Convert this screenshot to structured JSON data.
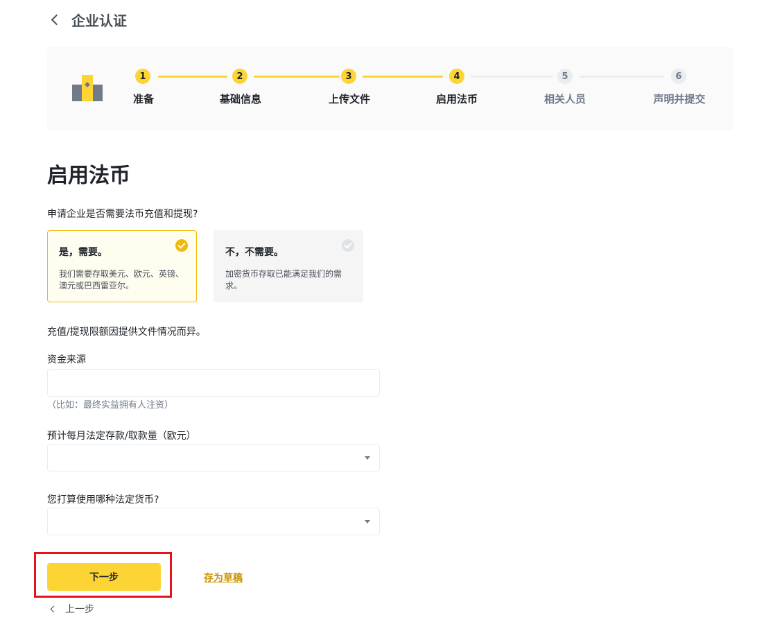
{
  "header": {
    "title": "企业认证"
  },
  "steps": [
    {
      "number": "1",
      "label": "准备",
      "state": "done"
    },
    {
      "number": "2",
      "label": "基础信息",
      "state": "done"
    },
    {
      "number": "3",
      "label": "上传文件",
      "state": "done"
    },
    {
      "number": "4",
      "label": "启用法币",
      "state": "current"
    },
    {
      "number": "5",
      "label": "相关人员",
      "state": "todo"
    },
    {
      "number": "6",
      "label": "声明并提交",
      "state": "todo"
    }
  ],
  "section": {
    "title": "启用法币",
    "question": "申请企业是否需要法币充值和提现?"
  },
  "options": [
    {
      "title": "是，需要。",
      "description": "我们需要存取美元、欧元、英镑、澳元或巴西雷亚尔。",
      "selected": true
    },
    {
      "title": "不，不需要。",
      "description": "加密货币存取已能满足我们的需求。",
      "selected": false
    }
  ],
  "limit_note": "充值/提现限额因提供文件情况而异。",
  "fields": {
    "source_of_funds": {
      "label": "资金来源",
      "value": "",
      "hint": "（比如：最终实益拥有人注资）"
    },
    "monthly_volume": {
      "label": "预计每月法定存款/取款量（欧元）",
      "value": ""
    },
    "fiat_currency": {
      "label": "您打算使用哪种法定货币?",
      "value": ""
    }
  },
  "actions": {
    "next": "下一步",
    "save_draft": "存为草稿",
    "previous": "上一步"
  },
  "colors": {
    "accent": "#fcd535",
    "accent_dark": "#f0b90b",
    "link": "#c99400",
    "highlight": "#e5131c"
  }
}
